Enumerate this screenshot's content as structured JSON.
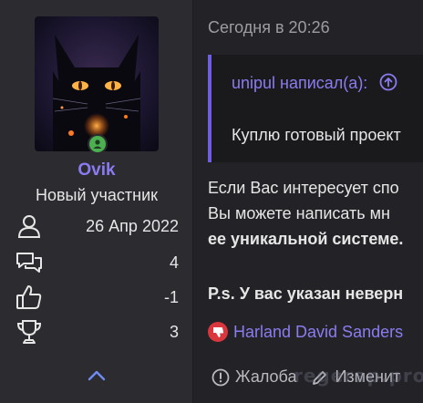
{
  "post": {
    "date": "Сегодня в 20:26",
    "quote": {
      "author": "unipul написал(а):",
      "text": "Куплю готовый проект"
    },
    "body_lines": [
      "Если Вас интересует спо",
      "Вы можете написать мн",
      "ее уникальной системе.",
      "P.s. У вас указан неверн"
    ],
    "reaction_user": "Harland David Sanders",
    "actions": {
      "report": "Жалоба",
      "edit": "Изменит"
    }
  },
  "user": {
    "name": "Ovik",
    "title": "Новый участник",
    "stats": [
      {
        "icon": "user-icon",
        "value": "26 Апр 2022"
      },
      {
        "icon": "messages-icon",
        "value": "4"
      },
      {
        "icon": "thumbs-up-icon",
        "value": "-1"
      },
      {
        "icon": "trophy-icon",
        "value": "3"
      }
    ]
  },
  "watermark": "regerap.pro",
  "colors": {
    "accent": "#8a7cf0",
    "online": "#4caf50",
    "dislike": "#d9363e"
  }
}
